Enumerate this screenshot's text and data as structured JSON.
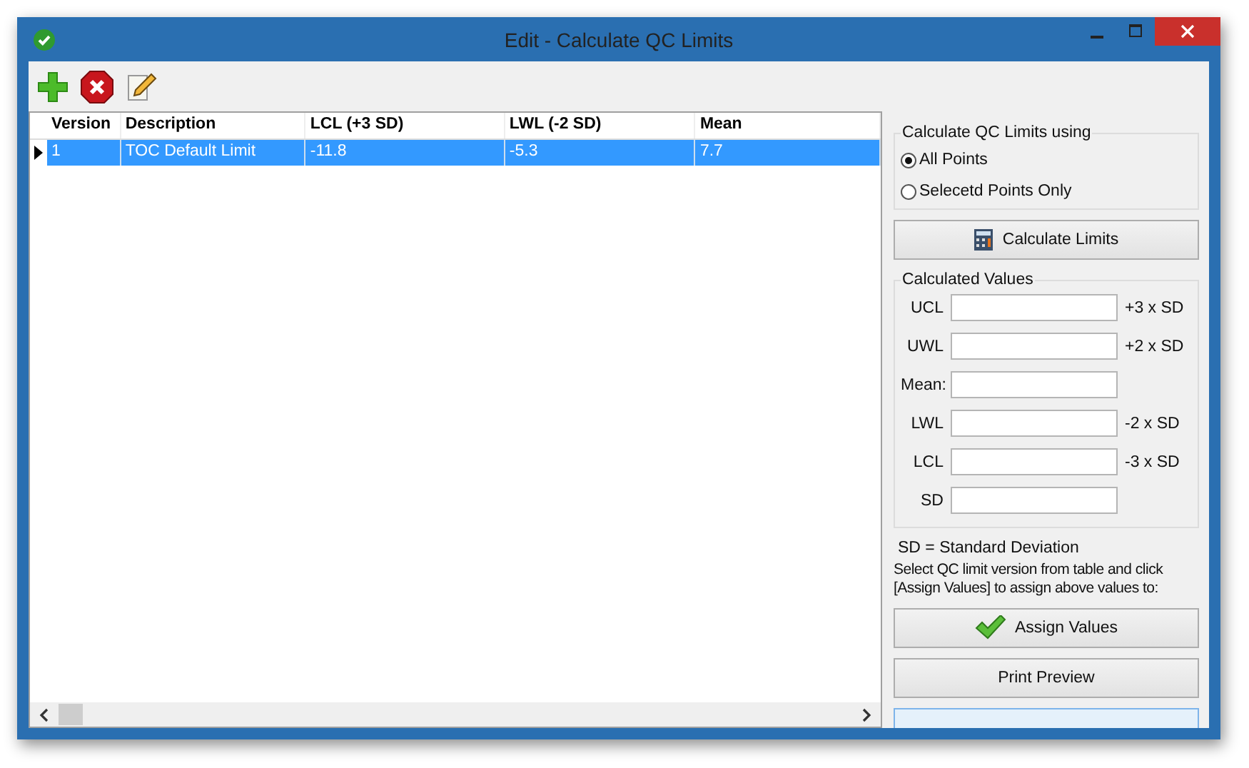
{
  "window": {
    "title": "Edit - Calculate QC Limits"
  },
  "table": {
    "columns": [
      "Version",
      "Description",
      "LCL (+3 SD)",
      "LWL (-2 SD)",
      "Mean"
    ],
    "rows": [
      {
        "selected": true,
        "cells": [
          "1",
          "TOC Default Limit",
          "-11.8",
          "-5.3",
          "7.7"
        ]
      }
    ]
  },
  "calc_mode": {
    "title": "Calculate QC Limits using",
    "options": [
      {
        "label": "All Points",
        "selected": true
      },
      {
        "label": "Selecetd Points Only",
        "selected": false
      }
    ]
  },
  "calculate_button": "Calculate Limits",
  "calculated_values": {
    "title": "Calculated Values",
    "fields": [
      {
        "label": "UCL",
        "suffix": "+3 x SD"
      },
      {
        "label": "UWL",
        "suffix": "+2 x SD"
      },
      {
        "label": "Mean:"
      },
      {
        "label": "LWL",
        "suffix": "-2 x SD"
      },
      {
        "label": "LCL",
        "suffix": "-3 x SD"
      },
      {
        "label": "SD"
      }
    ]
  },
  "legend": "SD = Standard Deviation",
  "instructions": "Select QC limit version from table and click [Assign Values] to assign above values to:",
  "assign_button": "Assign Values",
  "print_button": "Print Preview"
}
